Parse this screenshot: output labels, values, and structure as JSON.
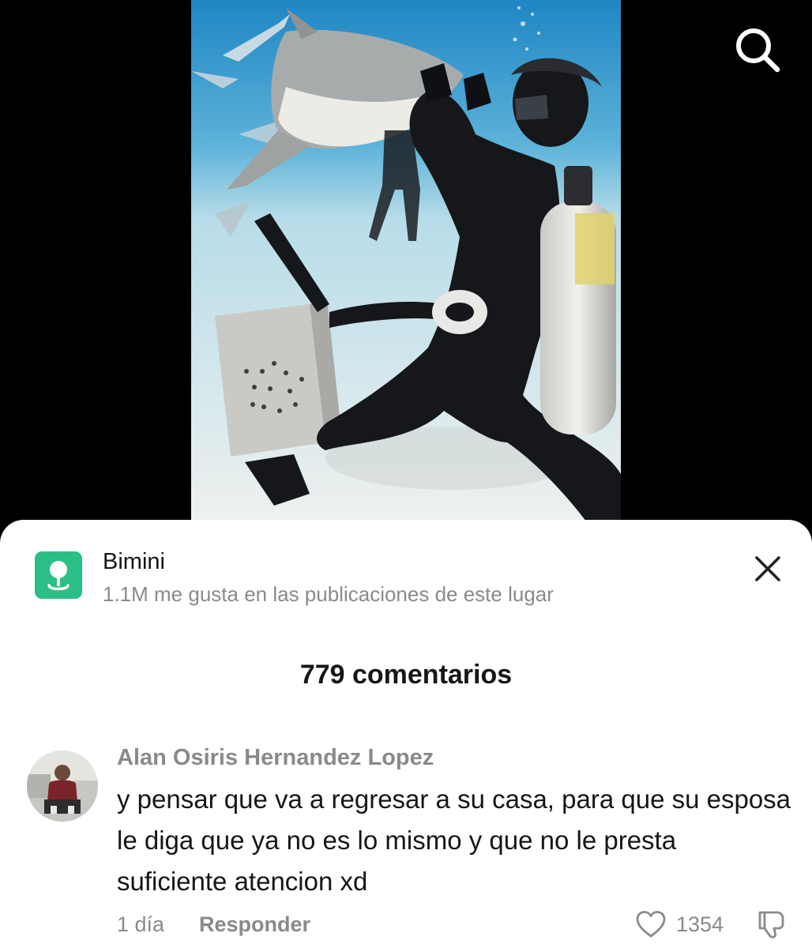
{
  "video": {
    "search_icon": "search-icon"
  },
  "place": {
    "icon": "location-pin-icon",
    "icon_color": "#2bbf86",
    "name": "Bimini",
    "subtitle": "1.1M me gusta en las publicaciones de este lugar",
    "close_icon": "close-icon"
  },
  "comments_header": {
    "count_label": "779 comentarios"
  },
  "comment": {
    "author": "Alan Osiris Hernandez Lopez",
    "text": "y pensar que va a regresar a su casa, para que su esposa le diga que ya no es lo mismo y que no le presta suficiente atencion xd",
    "time": "1 día",
    "reply_label": "Responder",
    "like_icon": "heart-icon",
    "like_count": "1354",
    "dislike_icon": "thumbs-down-icon"
  },
  "colors": {
    "text_primary": "#161616",
    "text_secondary": "#8a8a8a",
    "sheet_bg": "#ffffff",
    "video_bg": "#000000"
  }
}
